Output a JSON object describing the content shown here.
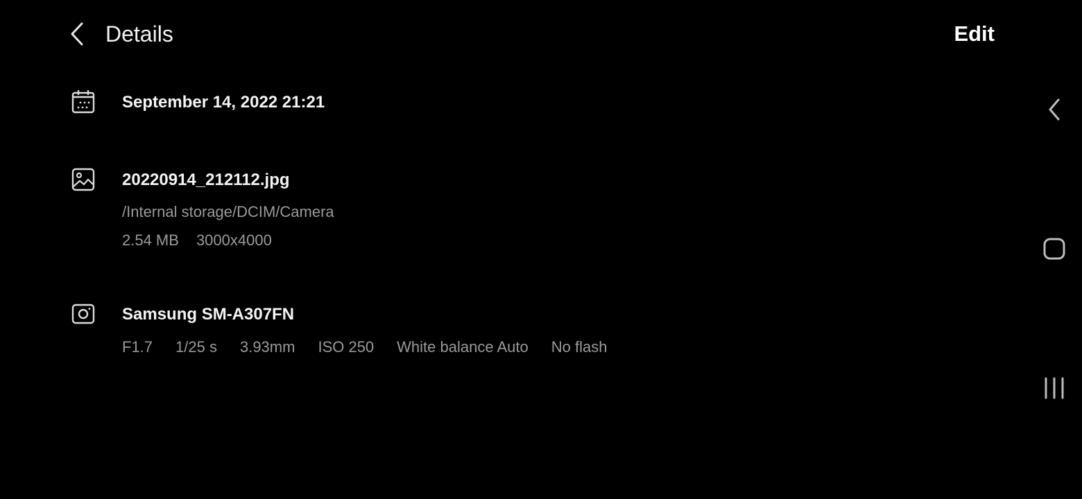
{
  "header": {
    "title": "Details",
    "edit_label": "Edit"
  },
  "date_row": {
    "icon": "calendar-icon",
    "datetime": "September 14, 2022 21:21"
  },
  "file_row": {
    "icon": "image-icon",
    "filename": "20220914_212112.jpg",
    "path": "/Internal storage/DCIM/Camera",
    "size": "2.54 MB",
    "resolution": "3000x4000"
  },
  "camera_row": {
    "icon": "camera-icon",
    "device": "Samsung SM-A307FN",
    "aperture": "F1.7",
    "shutter": "1/25 s",
    "focal_length": "3.93mm",
    "iso": "ISO 250",
    "white_balance": "White balance Auto",
    "flash": "No flash"
  },
  "navigation": {
    "back_icon": "nav-back-icon",
    "home_icon": "nav-home-icon",
    "recents_icon": "nav-recents-icon"
  },
  "colors": {
    "background": "#000000",
    "primary_text": "#f4f4f4",
    "secondary_text": "#9a9a9a"
  }
}
